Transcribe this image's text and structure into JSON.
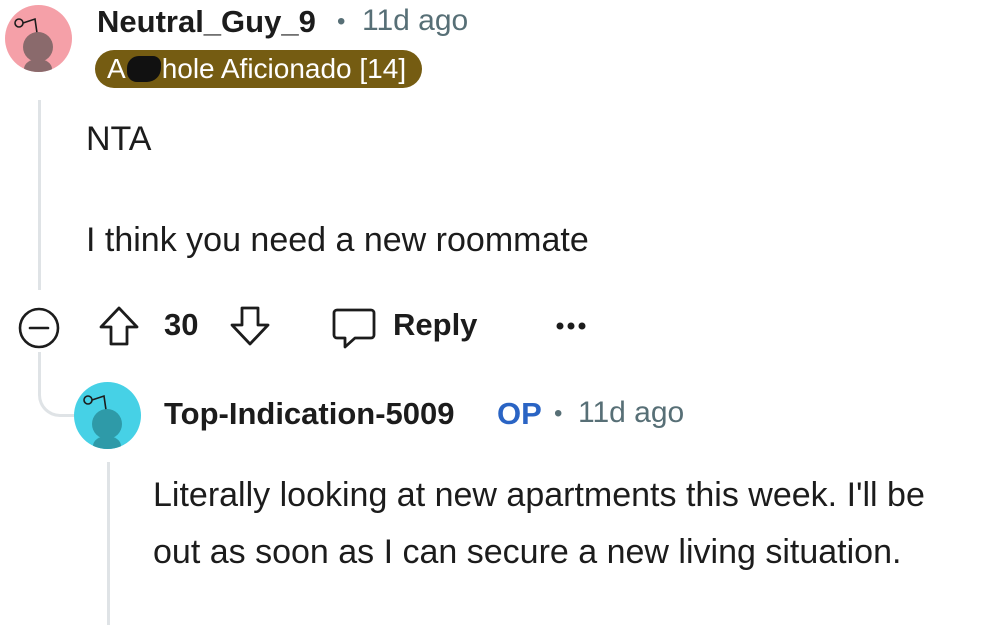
{
  "comment": {
    "username": "Neutral_Guy_9",
    "separator": "•",
    "time": "11d ago",
    "flair": {
      "prefix": "A",
      "suffix": "hole Aficionado [14]",
      "color": "#755c12"
    },
    "avatar_color": "#f5a0a8",
    "lines": [
      "NTA",
      "I think you need a new roommate"
    ],
    "votes": "30",
    "reply_label": "Reply",
    "more_label": "•••"
  },
  "reply": {
    "username": "Top-Indication-5009",
    "op_badge": "OP",
    "separator": "•",
    "time": "11d ago",
    "avatar_color": "#46d1e6",
    "text": "Literally looking at new apartments this week. I'll be out as soon as I can secure a new living situation."
  },
  "colors": {
    "text": "#1c1c1c",
    "meta": "#576f76",
    "op": "#2a64c4",
    "thread_line": "#dfe3e6"
  },
  "icons": [
    "snoo-avatar-icon",
    "collapse-minus-icon",
    "upvote-arrow-icon",
    "downvote-arrow-icon",
    "comment-bubble-icon",
    "more-dots-icon"
  ]
}
